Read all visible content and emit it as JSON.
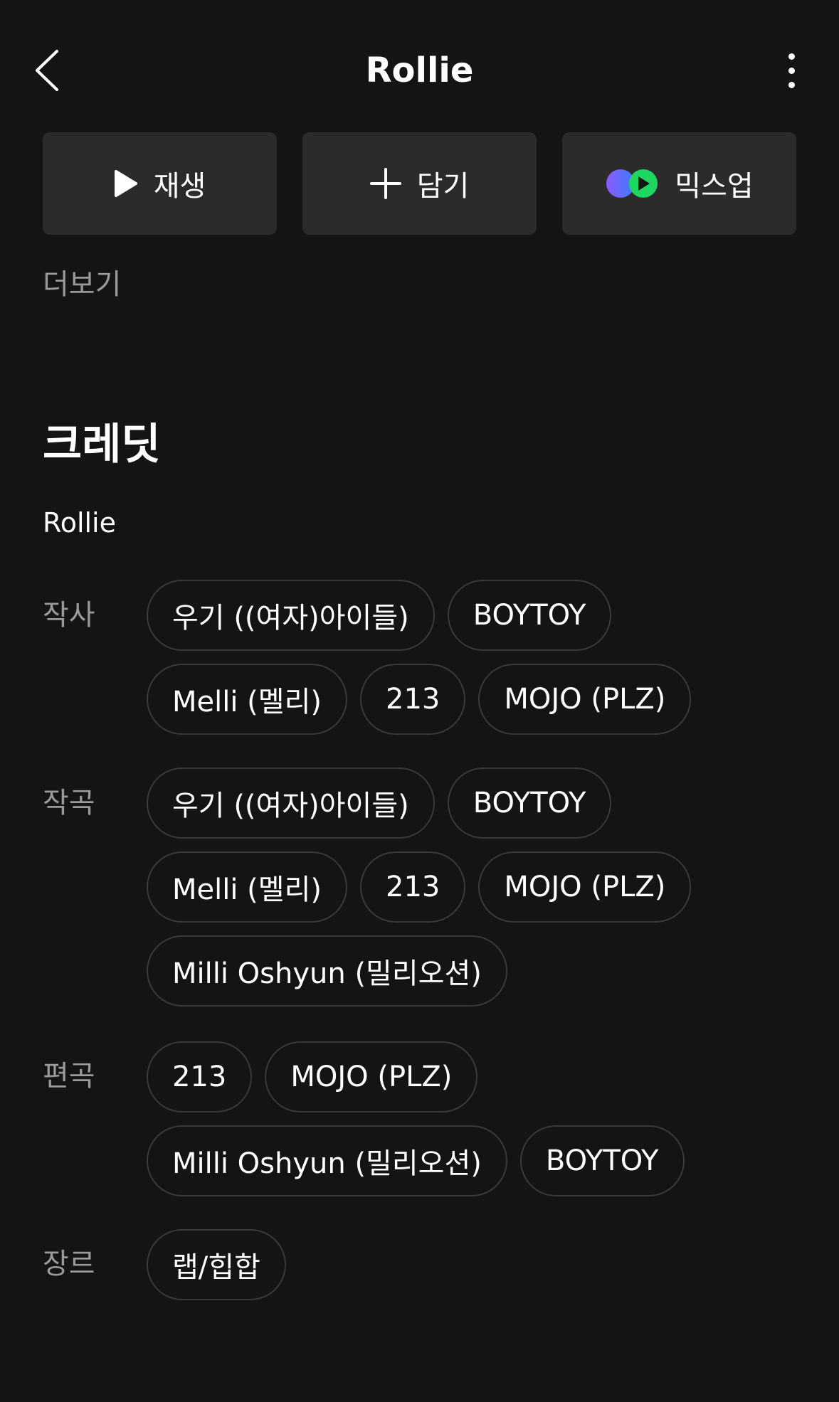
{
  "header": {
    "title": "Rollie"
  },
  "actions": {
    "play_label": "재생",
    "add_label": "담기",
    "mixup_label": "믹스업"
  },
  "more_label": "더보기",
  "credits": {
    "heading": "크레딧",
    "song": "Rollie",
    "lyricist": {
      "label": "작사",
      "names": [
        "우기 ((여자)아이들)",
        "BOYTOY",
        "Melli (멜리)",
        "213",
        "MOJO (PLZ)"
      ]
    },
    "composer": {
      "label": "작곡",
      "names": [
        "우기 ((여자)아이들)",
        "BOYTOY",
        "Melli (멜리)",
        "213",
        "MOJO (PLZ)",
        "Milli Oshyun (밀리오션)"
      ]
    },
    "arranger": {
      "label": "편곡",
      "names": [
        "213",
        "MOJO (PLZ)",
        "Milli Oshyun (밀리오션)",
        "BOYTOY"
      ]
    },
    "genre": {
      "label": "장르",
      "names": [
        "랩/힙합"
      ]
    }
  },
  "colors": {
    "background": "#141414",
    "button_bg": "#2b2b2b",
    "muted_text": "#9a9a9a",
    "chip_border": "#3a3a3a",
    "mixup_purple": "#7b5cff",
    "mixup_green": "#1ed760"
  },
  "icons": {
    "back": "chevron-left-icon",
    "more": "more-vertical-icon",
    "play": "play-icon",
    "add": "plus-icon",
    "mixup": "mixup-icon"
  }
}
